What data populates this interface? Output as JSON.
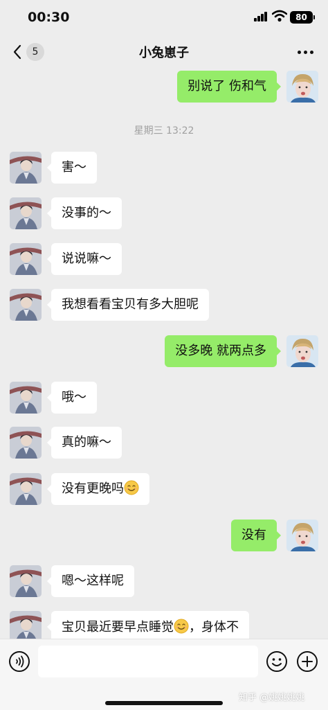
{
  "status_bar": {
    "time": "00:30",
    "battery": "80"
  },
  "nav": {
    "back_count": "5",
    "title": "小兔崽子"
  },
  "messages": [
    {
      "side": "right",
      "text": "别说了 伤和气"
    },
    {
      "type": "timestamp",
      "text": "星期三 13:22"
    },
    {
      "side": "left",
      "text": "害～"
    },
    {
      "side": "left",
      "text": "没事的～"
    },
    {
      "side": "left",
      "text": "说说嘛～"
    },
    {
      "side": "left",
      "text": "我想看看宝贝有多大胆呢"
    },
    {
      "side": "right",
      "text": "没多晚 就两点多"
    },
    {
      "side": "left",
      "text": "哦～"
    },
    {
      "side": "left",
      "text": "真的嘛～"
    },
    {
      "side": "left",
      "text": "没有更晚吗",
      "emoji": "smiling-face"
    },
    {
      "side": "right",
      "text": "没有"
    },
    {
      "side": "left",
      "text": "嗯～这样呢"
    },
    {
      "side": "left",
      "text": "宝贝最近要早点睡觉",
      "emoji": "smiling-face",
      "text_after": "，身体不"
    }
  ],
  "input_bar": {
    "placeholder": "",
    "watermark": "知乎 @姚姚姚姚"
  },
  "colors": {
    "background": "#ededed",
    "sent_bubble": "#95ec69",
    "received_bubble": "#ffffff",
    "timestamp_text": "#a0a0a0"
  },
  "icons": [
    "back-chevron-icon",
    "more-icon",
    "voice-icon",
    "emoji-icon",
    "plus-icon",
    "signal-icon",
    "wifi-icon",
    "battery-icon"
  ]
}
